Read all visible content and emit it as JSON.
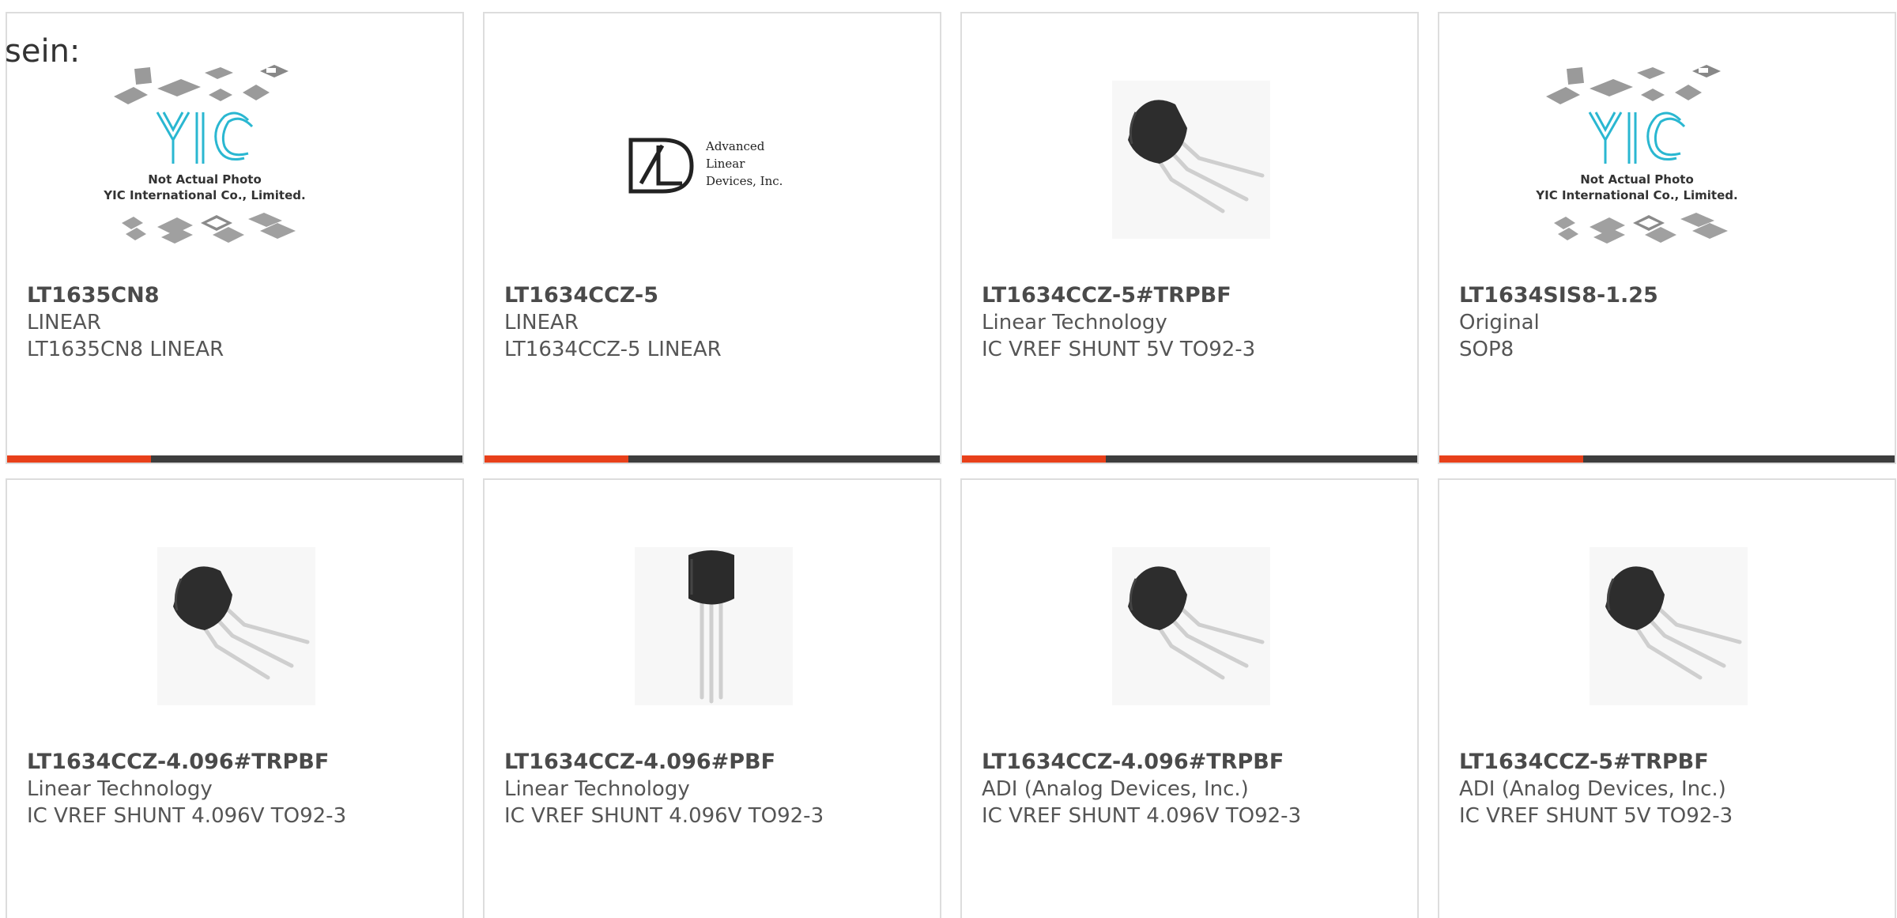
{
  "stray_text": "sein:",
  "yic_placeholder": {
    "brand": "YIC",
    "caption_line1": "Not Actual Photo",
    "caption_line2": "YIC International Co., Limited."
  },
  "adl_logo": {
    "line1": "Advanced",
    "line2": "Linear",
    "line3": "Devices, Inc."
  },
  "accent_color": "#e8401a",
  "bar_color": "#3d3d3d",
  "products": [
    {
      "part": "LT1635CN8",
      "maker": "LINEAR",
      "desc": "LT1635CN8 LINEAR",
      "image": "yic-placeholder-image"
    },
    {
      "part": "LT1634CCZ-5",
      "maker": "LINEAR",
      "desc": "LT1634CCZ-5 LINEAR",
      "image": "adl-logo-image"
    },
    {
      "part": "LT1634CCZ-5#TRPBF",
      "maker": "Linear Technology",
      "desc": "IC VREF SHUNT 5V TO92-3",
      "image": "to92-bent-image"
    },
    {
      "part": "LT1634SIS8-1.25",
      "maker": "Original",
      "desc": "SOP8",
      "image": "yic-placeholder-image"
    },
    {
      "part": "LT1634CCZ-4.096#TRPBF",
      "maker": "Linear Technology",
      "desc": "IC VREF SHUNT 4.096V TO92-3",
      "image": "to92-bent-image"
    },
    {
      "part": "LT1634CCZ-4.096#PBF",
      "maker": "Linear Technology",
      "desc": "IC VREF SHUNT 4.096V TO92-3",
      "image": "to92-straight-image"
    },
    {
      "part": "LT1634CCZ-4.096#TRPBF",
      "maker": "ADI (Analog Devices, Inc.)",
      "desc": "IC VREF SHUNT 4.096V TO92-3",
      "image": "to92-bent-image"
    },
    {
      "part": "LT1634CCZ-5#TRPBF",
      "maker": "ADI (Analog Devices, Inc.)",
      "desc": "IC VREF SHUNT 5V TO92-3",
      "image": "to92-bent-image"
    }
  ]
}
